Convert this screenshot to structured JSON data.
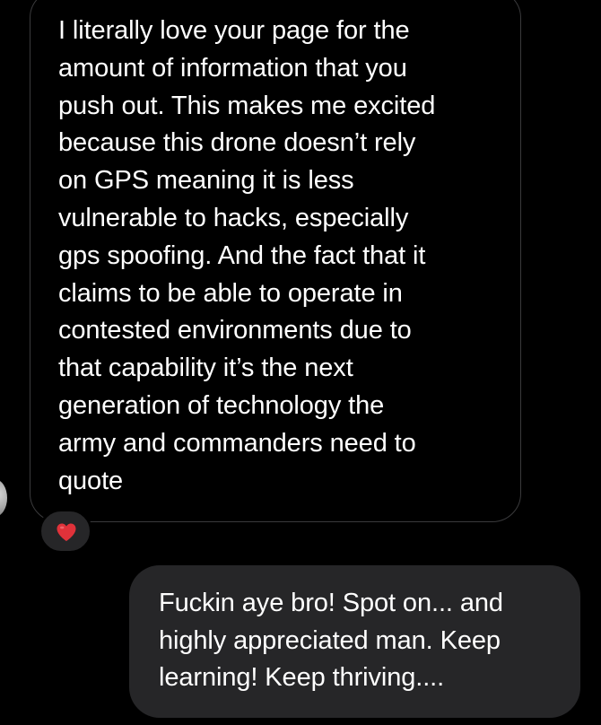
{
  "conversation": {
    "incoming_message": {
      "text": "I literally love your page for the\namount of information that you\npush out. This makes me excited\nbecause this drone doesn’t rely\non GPS meaning it is less\nvulnerable to hacks, especially\ngps spoofing. And the fact that it\nclaims to be able to operate in\ncontested environments due to\nthat capability it’s the next\ngeneration of technology the\narmy and commanders need to\nquote",
      "reaction": {
        "icon": "red-heart-icon",
        "color": "#e0323a"
      }
    },
    "outgoing_message": {
      "text": "Fuckin aye bro! Spot on... and\nhighly appreciated man. Keep\nlearning! Keep thriving...."
    }
  },
  "colors": {
    "background": "#000000",
    "outgoing_bubble": "#262628",
    "incoming_border": "#3a3a3c",
    "text": "#ffffff"
  }
}
